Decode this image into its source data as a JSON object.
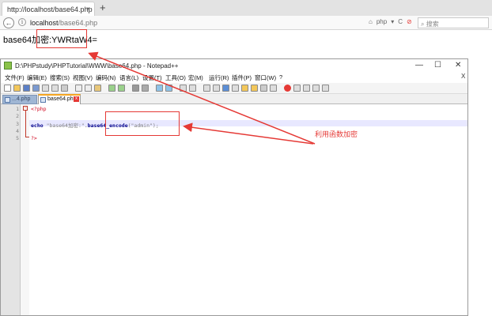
{
  "browser": {
    "tab_title": "http://localhost/base64.php",
    "tab_close": "×",
    "new_tab": "+",
    "back": "←",
    "info": "i",
    "url_host": "localhost",
    "url_path": "/base64.php",
    "nav_icons": [
      "⌂",
      "php",
      "▾",
      "C",
      "⊘"
    ],
    "search_placeholder": "搜索"
  },
  "page": {
    "output_text": "base64加密:YWRtaW4="
  },
  "notepad": {
    "title": "D:\\PHPstudy\\PHPTutorial\\WWW\\base64.php - Notepad++",
    "window_controls": [
      "—",
      "☐",
      "✕"
    ],
    "menu": [
      "文件(F)",
      "编辑(E)",
      "搜索(S)",
      "视图(V)",
      "编码(N)",
      "语言(L)",
      "设置(T)",
      "工具(O)",
      "宏(M)",
      "运行(R)",
      "插件(P)",
      "窗口(W)",
      "?"
    ],
    "menu_close": "X",
    "tabs": [
      {
        "label": "...4.php"
      },
      {
        "label": "base64.php",
        "close": "x"
      }
    ],
    "line_numbers": [
      "1",
      "2",
      "3",
      "4",
      "5"
    ],
    "code": {
      "line1": "<?php",
      "line3_echo": "echo",
      "line3_str": "\"base64加密:\"",
      "line3_dot": ".",
      "line3_fn": "base64_encode",
      "line3_arg": "(\"admin\");",
      "line5": "?>"
    },
    "fold_open": "−"
  },
  "annotation": {
    "label": "利用函数加密",
    "color": "#e53935"
  }
}
